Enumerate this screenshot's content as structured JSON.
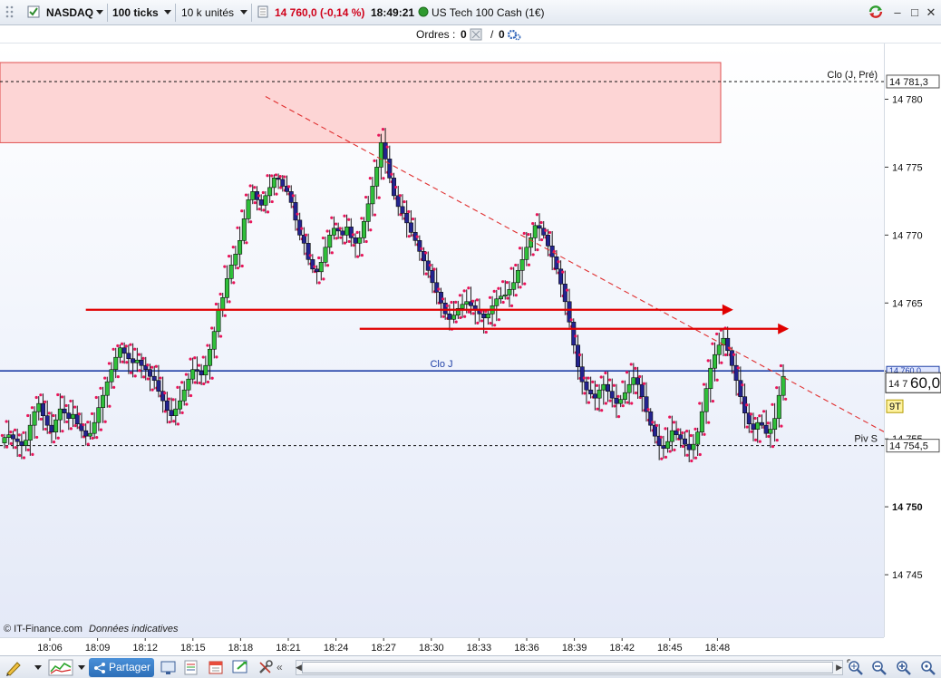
{
  "toolbar": {
    "symbol": "NASDAQ",
    "interval": "100 ticks",
    "volume": "10 k unités",
    "last_price": "14 760,0 (-0,14 %)",
    "time": "18:49:21",
    "instrument": "US Tech 100 Cash (1€)"
  },
  "orders": {
    "label": "Ordres :",
    "count_a": "0",
    "separator": "/",
    "count_b": "0"
  },
  "chart_data": {
    "type": "candlestick",
    "price_ticks": [
      "14 780",
      "14 775",
      "14 770",
      "14 765",
      "14 760",
      "14 755",
      "14 750",
      "14 745"
    ],
    "price_tick_values": [
      14780,
      14775,
      14770,
      14765,
      14760,
      14755,
      14750,
      14745
    ],
    "time_ticks": [
      "18:06",
      "18:09",
      "18:12",
      "18:15",
      "18:18",
      "18:21",
      "18:24",
      "18:27",
      "18:30",
      "18:33",
      "18:36",
      "18:39",
      "18:42",
      "18:45",
      "18:48"
    ],
    "ylim": [
      14740.4,
      14784.1
    ],
    "closes": [
      14755.1,
      14755.3,
      14755.0,
      14754.8,
      14754.5,
      14754.9,
      14756.0,
      14757.0,
      14757.6,
      14756.7,
      14756.0,
      14755.5,
      14756.4,
      14757.2,
      14756.9,
      14756.5,
      14756.8,
      14756.1,
      14755.6,
      14755.2,
      14755.4,
      14756.2,
      14757.3,
      14758.2,
      14759.2,
      14760.1,
      14761.0,
      14761.7,
      14761.3,
      14760.9,
      14760.6,
      14760.8,
      14760.4,
      14760.1,
      14759.6,
      14759.3,
      14758.5,
      14757.8,
      14757.1,
      14756.7,
      14757.2,
      14757.8,
      14758.6,
      14759.4,
      14760.1,
      14760.0,
      14759.7,
      14760.4,
      14761.6,
      14762.9,
      14764.5,
      14765.4,
      14766.8,
      14767.8,
      14768.6,
      14769.6,
      14771.2,
      14772.6,
      14773.2,
      14772.6,
      14772.2,
      14772.9,
      14773.5,
      14774.2,
      14774.1,
      14773.6,
      14773.2,
      14772.4,
      14771.1,
      14770.0,
      14769.4,
      14768.2,
      14767.5,
      14767.3,
      14768.0,
      14769.1,
      14770.0,
      14770.5,
      14770.3,
      14770.0,
      14770.6,
      14769.8,
      14769.4,
      14769.8,
      14771.0,
      14772.3,
      14773.6,
      14775.0,
      14776.8,
      14775.6,
      14774.2,
      14772.9,
      14772.1,
      14771.6,
      14770.9,
      14770.2,
      14769.6,
      14768.8,
      14768.1,
      14767.4,
      14766.5,
      14765.8,
      14765.0,
      14764.2,
      14763.8,
      14764.1,
      14764.6,
      14764.9,
      14765.1,
      14764.8,
      14764.5,
      14764.2,
      14763.9,
      14764.2,
      14764.8,
      14765.3,
      14765.5,
      14765.6,
      14766.0,
      14766.5,
      14767.4,
      14768.2,
      14769.1,
      14769.8,
      14770.7,
      14770.5,
      14770.0,
      14769.2,
      14768.4,
      14767.5,
      14766.4,
      14765.1,
      14763.6,
      14761.9,
      14760.3,
      14759.2,
      14758.6,
      14758.3,
      14758.0,
      14758.6,
      14759.0,
      14758.5,
      14758.0,
      14757.6,
      14757.9,
      14758.4,
      14759.0,
      14759.5,
      14759.0,
      14758.1,
      14757.0,
      14756.0,
      14755.2,
      14754.5,
      14754.3,
      14754.8,
      14755.6,
      14755.3,
      14755.0,
      14754.6,
      14754.2,
      14754.6,
      14755.5,
      14757.0,
      14758.7,
      14760.2,
      14761.2,
      14761.9,
      14762.4,
      14761.5,
      14760.4,
      14759.3,
      14758.1,
      14756.9,
      14756.1,
      14755.7,
      14756.2,
      14756.0,
      14755.4,
      14755.7,
      14756.5,
      14758.2,
      14759.6
    ],
    "levels": [
      {
        "label": "Clo (J, Pré)",
        "value": "14 781,3",
        "price": 14781.3,
        "style": "dashed"
      },
      {
        "label": "Clo J",
        "value": "14 760,0",
        "price": 14760.0,
        "style": "solid"
      },
      {
        "label": "Piv S",
        "value": "14 754,5",
        "price": 14754.5,
        "style": "dashed"
      }
    ],
    "current_price": {
      "prefix": "14 7",
      "big": "60,0",
      "price": 14760.0
    },
    "tag": "9T",
    "zone": {
      "from_price": 14782.7,
      "to_price": 14776.8
    },
    "arrows": [
      {
        "price": 14764.5,
        "from_index": 19,
        "to_index": 147
      },
      {
        "price": 14763.1,
        "from_index": 83,
        "to_index": 160
      }
    ],
    "trendline": {
      "from_index": 61,
      "from_price": 14780.2,
      "to_index": 169,
      "to_price": 14753.8
    },
    "colors": {
      "up": "#2fbf3a",
      "down": "#23238f",
      "wick": "#1a1a1a",
      "dot": "#e8155a",
      "level_blue": "#1f3fa6",
      "arrow_red": "#e00000",
      "zone_fill": "#fdd5d5",
      "zone_border": "#e05050"
    }
  },
  "footer": {
    "copyright": "© IT-Finance.com",
    "note": "Données indicatives"
  },
  "bottombar": {
    "share_label": "Partager"
  }
}
